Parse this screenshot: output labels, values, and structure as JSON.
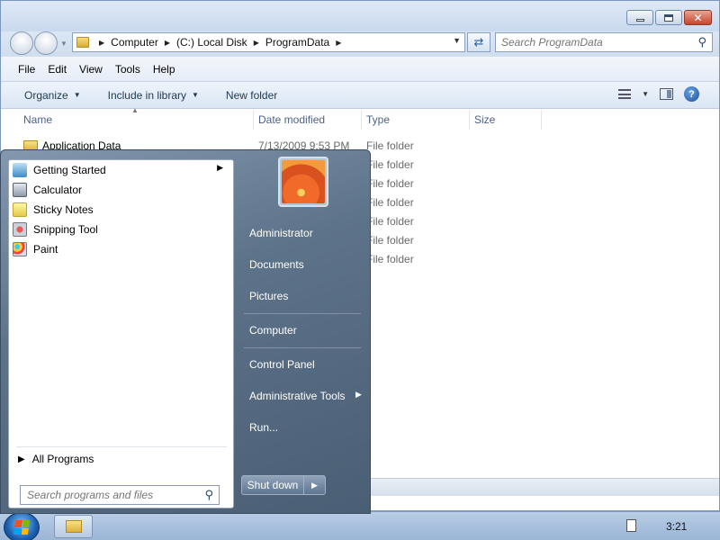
{
  "window_controls": {
    "minimize": "",
    "maximize": "",
    "close": "✕"
  },
  "address": {
    "crumbs": [
      "Computer",
      "(C:) Local Disk",
      "ProgramData"
    ],
    "search_placeholder": "Search ProgramData"
  },
  "menubar": [
    "File",
    "Edit",
    "View",
    "Tools",
    "Help"
  ],
  "toolbar": {
    "organize": "Organize",
    "include_in_library": "Include in library",
    "new_folder": "New folder",
    "help_glyph": "?"
  },
  "columns": {
    "name": "Name",
    "date_modified": "Date modified",
    "type": "Type",
    "size": "Size"
  },
  "files": [
    {
      "name": "Application Data",
      "date": "7/13/2009 9:53 PM",
      "type": "File folder"
    },
    {
      "type": "File folder"
    },
    {
      "type": "File folder"
    },
    {
      "type": "File folder"
    },
    {
      "type": "File folder"
    },
    {
      "type": "File folder"
    },
    {
      "type": "File folder"
    }
  ],
  "start_menu": {
    "programs": [
      {
        "label": "Getting Started",
        "icon": "getting-started-icon",
        "has_submenu": true
      },
      {
        "label": "Calculator",
        "icon": "calculator-icon"
      },
      {
        "label": "Sticky Notes",
        "icon": "sticky-notes-icon"
      },
      {
        "label": "Snipping Tool",
        "icon": "snipping-tool-icon"
      },
      {
        "label": "Paint",
        "icon": "paint-icon"
      }
    ],
    "all_programs": "All Programs",
    "search_placeholder": "Search programs and files",
    "right_items": {
      "user": "Administrator",
      "documents": "Documents",
      "pictures": "Pictures",
      "computer": "Computer",
      "control_panel": "Control Panel",
      "admin_tools": "Administrative Tools",
      "run": "Run..."
    },
    "shutdown": "Shut down"
  },
  "taskbar": {
    "clock": "3:21"
  }
}
